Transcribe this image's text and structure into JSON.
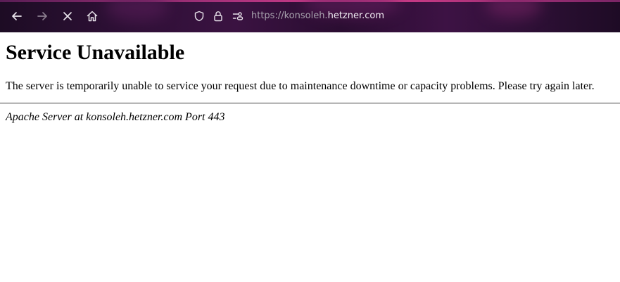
{
  "browser": {
    "toolbar": {
      "back_icon": "arrow-left-icon",
      "forward_icon": "arrow-right-icon",
      "stop_icon": "close-icon",
      "home_icon": "home-icon"
    },
    "urlbar": {
      "scheme_and_subdomain": "https://konsoleh.",
      "domain": "hetzner.com",
      "shield_icon": "shield-icon",
      "lock_icon": "lock-icon",
      "permissions_icon": "permissions-icon"
    },
    "colors": {
      "toolbar_bg": "#2c0f34",
      "accent": "#d43d8a",
      "url_dim": "#a8a3ae",
      "url_bright": "#f2eef4"
    }
  },
  "page": {
    "title": "Service Unavailable",
    "message": "The server is temporarily unable to service your request due to maintenance downtime or capacity problems. Please try again later.",
    "address": "Apache Server at konsoleh.hetzner.com Port 443"
  }
}
